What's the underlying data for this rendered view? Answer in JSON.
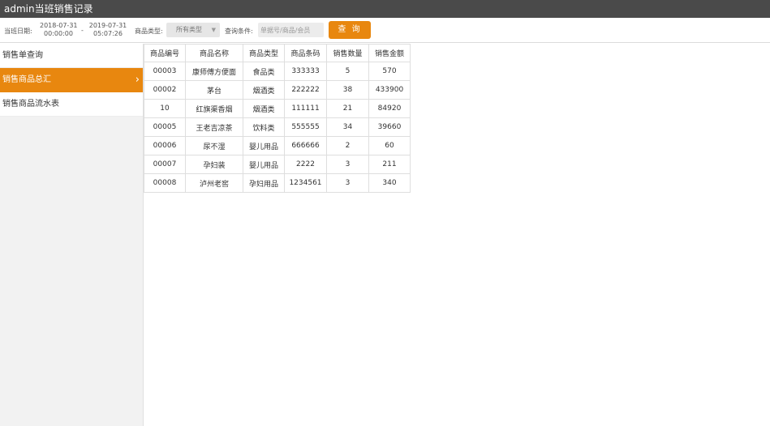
{
  "app": {
    "title": "admin当班销售记录"
  },
  "toolbar": {
    "shift_date_label": "当班日期:",
    "start_date": "2018-07-31",
    "start_time": "00:00:00",
    "separator": "-",
    "end_date": "2019-07-31",
    "end_time": "05:07:26",
    "category_label": "商品类型:",
    "category_value": "所有类型",
    "query_label": "查询条件:",
    "query_placeholder": "单据号/商品/会员",
    "query_button": "查 询"
  },
  "sidebar": {
    "items": [
      {
        "label": "销售单查询",
        "active": false
      },
      {
        "label": "销售商品总汇",
        "active": true
      },
      {
        "label": "销售商品流水表",
        "active": false
      }
    ]
  },
  "table": {
    "columns": [
      "商品编号",
      "商品名称",
      "商品类型",
      "商品条码",
      "销售数量",
      "销售金额"
    ],
    "rows": [
      [
        "00003",
        "康师傅方便面",
        "食品类",
        "333333",
        "5",
        "570"
      ],
      [
        "00002",
        "茅台",
        "烟酒类",
        "222222",
        "38",
        "433900"
      ],
      [
        "10",
        "红旗渠香烟",
        "烟酒类",
        "111111",
        "21",
        "84920"
      ],
      [
        "00005",
        "王老吉凉茶",
        "饮料类",
        "555555",
        "34",
        "39660"
      ],
      [
        "00006",
        "尿不湿",
        "婴儿用品",
        "666666",
        "2",
        "60"
      ],
      [
        "00007",
        "孕妇装",
        "婴儿用品",
        "2222",
        "3",
        "211"
      ],
      [
        "00008",
        "泸州老窖",
        "孕妇用品",
        "1234561",
        "3",
        "340"
      ]
    ]
  },
  "colors": {
    "accent": "#e8870f",
    "titlebar": "#4a4a4a",
    "sidebar_bg": "#f2f2f2"
  }
}
